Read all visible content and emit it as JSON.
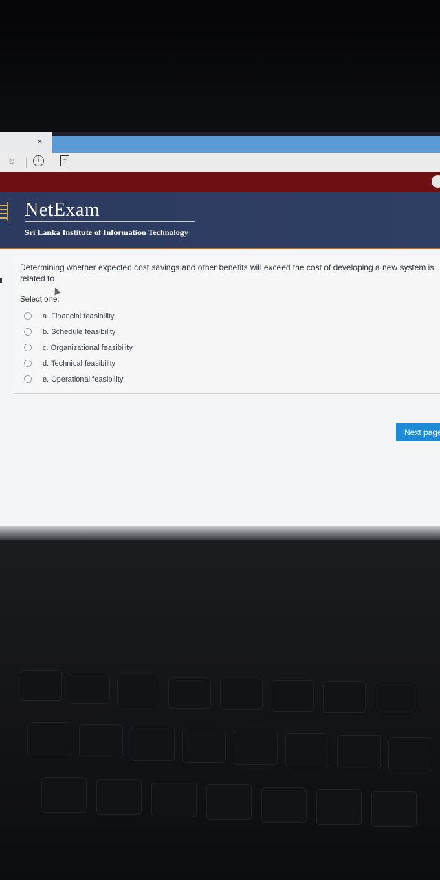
{
  "browser": {
    "tab_close_glyph": "×",
    "info_glyph": "i",
    "reload_glyph": "↻",
    "page_glyph": "+"
  },
  "header": {
    "brand": "NetExam",
    "institution": "Sri Lanka Institute of Information Technology"
  },
  "question": {
    "text": "Determining whether expected cost savings and other benefits will exceed the cost of developing a new system is related to",
    "prompt": "Select one:",
    "options": [
      {
        "label": "a. Financial feasibility",
        "selected": false
      },
      {
        "label": "b. Schedule feasibility",
        "selected": false
      },
      {
        "label": "c. Organizational feasibility",
        "selected": false
      },
      {
        "label": "d. Technical feasibility",
        "selected": false
      },
      {
        "label": "e. Operational feasibility",
        "selected": false
      }
    ]
  },
  "navigation": {
    "next_label": "Next page"
  },
  "colors": {
    "banner": "#2f3f63",
    "accent_bar": "#6d1013",
    "button": "#1f8ad7"
  }
}
